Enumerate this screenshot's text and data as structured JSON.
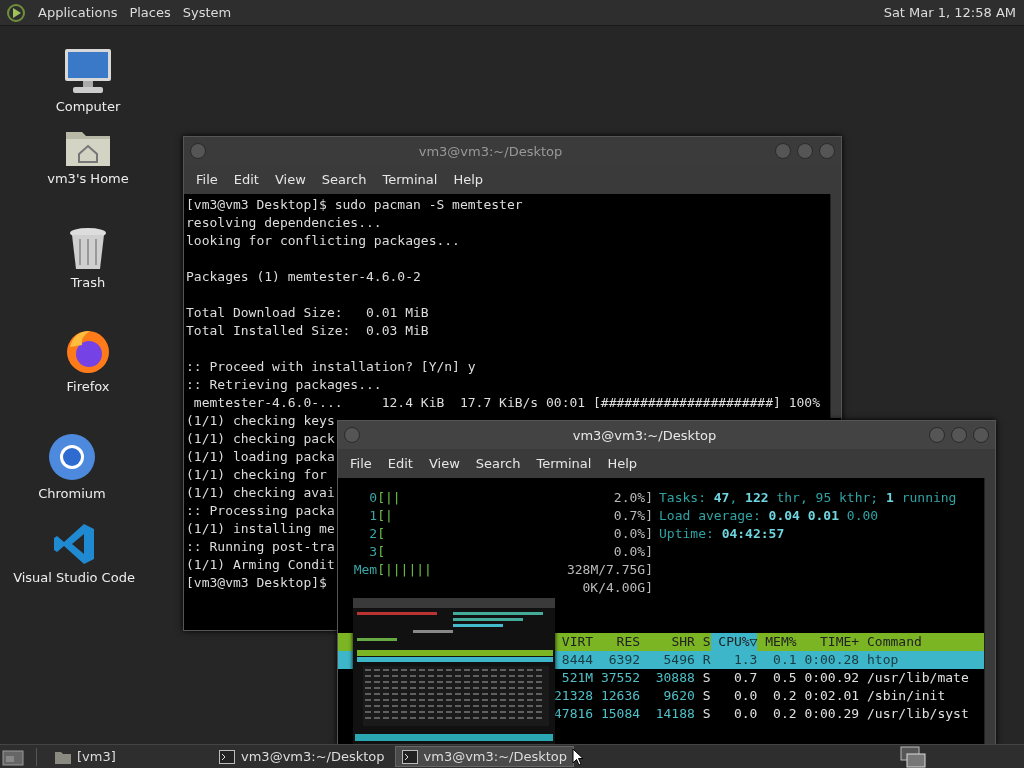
{
  "top_panel": {
    "menus": [
      "Applications",
      "Places",
      "System"
    ],
    "clock": "Sat Mar  1, 12:58 AM"
  },
  "desktop_icons": [
    {
      "label": "Computer",
      "kind": "computer"
    },
    {
      "label": "vm3's Home",
      "kind": "home"
    },
    {
      "label": "Trash",
      "kind": "trash"
    },
    {
      "label": "Firefox",
      "kind": "firefox"
    },
    {
      "label": "Chromium",
      "kind": "chromium"
    },
    {
      "label": "Visual Studio Code",
      "kind": "code"
    }
  ],
  "terminal_back": {
    "title": "vm3@vm3:~/Desktop",
    "active": false,
    "menu": [
      "File",
      "Edit",
      "View",
      "Search",
      "Terminal",
      "Help"
    ],
    "blocks": [
      [
        "[vm3@vm3 Desktop]$ sudo pacman -S memtester",
        "resolving dependencies...",
        "looking for conflicting packages..."
      ],
      [
        "Packages (1) memtester-4.6.0-2"
      ],
      [
        "Total Download Size:   0.01 MiB",
        "Total Installed Size:  0.03 MiB"
      ],
      [
        ":: Proceed with installation? [Y/n] y",
        ":: Retrieving packages...",
        " memtester-4.6.0-...     12.4 KiB  17.7 KiB/s 00:01 [######################] 100%",
        "(1/1) checking keys",
        "(1/1) checking pack",
        "(1/1) loading packa",
        "(1/1) checking for",
        "(1/1) checking avai",
        ":: Processing packa",
        "(1/1) installing me",
        ":: Running post-tra",
        "(1/1) Arming Condit",
        "[vm3@vm3 Desktop]$"
      ]
    ]
  },
  "terminal_front": {
    "title": "vm3@vm3:~/Desktop",
    "active": true,
    "menu": [
      "File",
      "Edit",
      "View",
      "Search",
      "Terminal",
      "Help"
    ],
    "meters": [
      {
        "label": "0",
        "bar": "[||",
        "reading": "2.0%]"
      },
      {
        "label": "1",
        "bar": "[|",
        "reading": "0.7%]"
      },
      {
        "label": "2",
        "bar": "[",
        "reading": "0.0%]"
      },
      {
        "label": "3",
        "bar": "[",
        "reading": "0.0%]"
      },
      {
        "label": "Mem",
        "bar": "[||||||",
        "reading": "328M/7.75G]"
      },
      {
        "reading": "0K/4.00G]"
      }
    ],
    "info": [
      "Tasks: **47**, **122** thr, 95 kthr; **1** running",
      "Load average: **0.04** **0.01** 0.00",
      "Uptime: **04:42:57**"
    ],
    "columns": [
      {
        "label": "VIRT",
        "selected": false
      },
      {
        "label": "RES",
        "selected": false
      },
      {
        "label": "SHR",
        "selected": false
      },
      {
        "label": "S",
        "selected": false
      },
      {
        "label": "CPU%▽",
        "selected": true
      },
      {
        "label": "MEM%",
        "selected": false
      },
      {
        "label": "TIME+",
        "selected": false
      },
      {
        "label": "Command",
        "selected": false
      }
    ],
    "rows": [
      {
        "selected": true,
        "cells": [
          "8444",
          "6392",
          "5496",
          "R",
          "1.3",
          "0.1",
          "0:00.28",
          "htop"
        ]
      },
      {
        "selected": false,
        "cells": [
          "521M",
          "37552",
          "30888",
          "S",
          "0.7",
          "0.5",
          "0:00.92",
          "/usr/lib/mate"
        ]
      },
      {
        "selected": false,
        "cells": [
          "21328",
          "12636",
          "9620",
          "S",
          "0.0",
          "0.2",
          "0:02.01",
          "/sbin/init"
        ]
      },
      {
        "selected": false,
        "cells": [
          "47816",
          "15084",
          "14188",
          "S",
          "0.0",
          "0.2",
          "0:00.29",
          "/usr/lib/syst"
        ]
      }
    ]
  },
  "taskbar": {
    "items": [
      {
        "label": "[vm3]",
        "kind": "folder",
        "selected": false
      },
      {
        "label": "vm3@vm3:~/Desktop",
        "kind": "terminal",
        "selected": false
      },
      {
        "label": "vm3@vm3:~/Desktop",
        "kind": "terminal",
        "selected": true
      }
    ]
  }
}
